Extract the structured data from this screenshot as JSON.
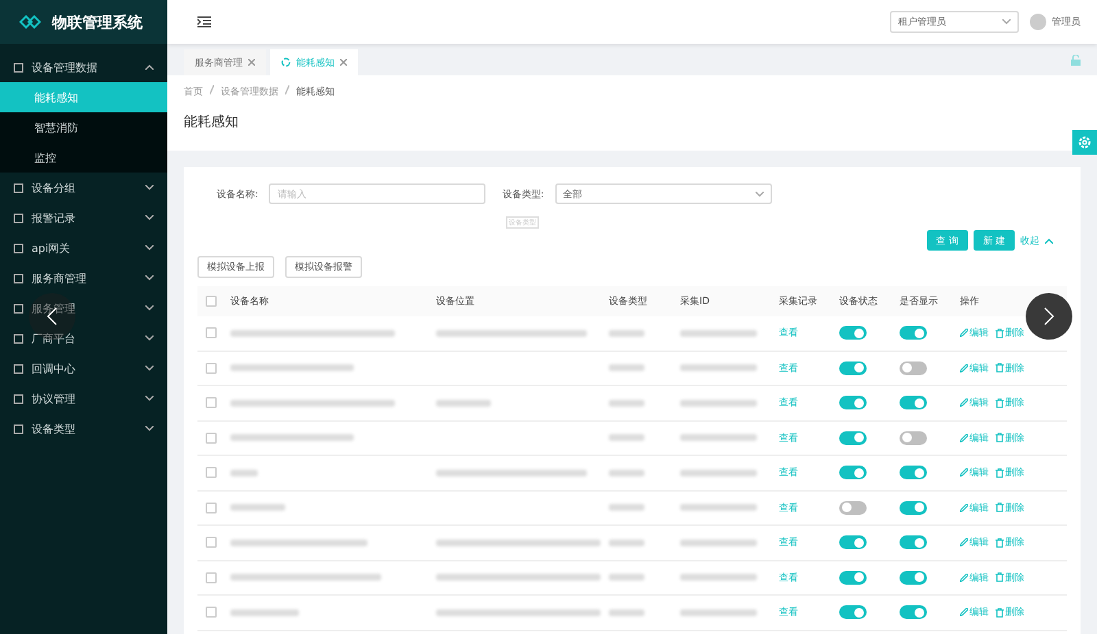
{
  "sidebar": {
    "title": "物联管理系统",
    "items": [
      {
        "label": "设备管理数据",
        "expanded": true,
        "children": [
          {
            "label": "能耗感知",
            "selected": true
          },
          {
            "label": "智慧消防",
            "selected": false
          },
          {
            "label": "监控",
            "selected": false
          }
        ]
      },
      {
        "label": "设备分组",
        "expanded": false
      },
      {
        "label": "报警记录",
        "expanded": false
      },
      {
        "label": "api网关",
        "expanded": false
      },
      {
        "label": "服务商管理",
        "expanded": false
      },
      {
        "label": "服务管理",
        "expanded": false
      },
      {
        "label": "厂商平台",
        "expanded": false
      },
      {
        "label": "回调中心",
        "expanded": false
      },
      {
        "label": "协议管理",
        "expanded": false
      },
      {
        "label": "设备类型",
        "expanded": false
      }
    ]
  },
  "header": {
    "role_select": "租户管理员",
    "user": "管理员"
  },
  "tabs": [
    {
      "label": "服务商管理",
      "selected": false
    },
    {
      "label": "能耗感知",
      "selected": true
    }
  ],
  "breadcrumb": [
    "首页",
    "设备管理数据",
    "能耗感知"
  ],
  "page_title": "能耗感知",
  "filters": {
    "name_label": "设备名称:",
    "name_placeholder": "请输入",
    "type_label": "设备类型:",
    "type_value": "全部",
    "type_hint": "设备类型"
  },
  "actions": {
    "query": "查 询",
    "create": "新 建",
    "collapse": "收起"
  },
  "tool_buttons": [
    "模拟设备上报",
    "模拟设备报警"
  ],
  "table": {
    "all_checked": false,
    "columns": [
      "设备名称",
      "设备位置",
      "设备类型",
      "采集ID",
      "采集记录",
      "设备状态",
      "是否显示",
      "操作"
    ],
    "rows": [
      {
        "checked": false,
        "record": "查看",
        "status_on": true,
        "display_on": true,
        "edit": "编辑",
        "delete": "删除"
      },
      {
        "checked": false,
        "record": "查看",
        "status_on": true,
        "display_on": false,
        "edit": "编辑",
        "delete": "删除"
      },
      {
        "checked": false,
        "record": "查看",
        "status_on": true,
        "display_on": true,
        "edit": "编辑",
        "delete": "删除"
      },
      {
        "checked": false,
        "record": "查看",
        "status_on": true,
        "display_on": false,
        "edit": "编辑",
        "delete": "删除"
      },
      {
        "checked": false,
        "record": "查看",
        "status_on": true,
        "display_on": true,
        "edit": "编辑",
        "delete": "删除"
      },
      {
        "checked": false,
        "record": "查看",
        "status_on": false,
        "display_on": true,
        "edit": "编辑",
        "delete": "删除"
      },
      {
        "checked": false,
        "record": "查看",
        "status_on": true,
        "display_on": true,
        "edit": "编辑",
        "delete": "删除"
      },
      {
        "checked": false,
        "record": "查看",
        "status_on": true,
        "display_on": true,
        "edit": "编辑",
        "delete": "删除"
      },
      {
        "checked": false,
        "record": "查看",
        "status_on": true,
        "display_on": true,
        "edit": "编辑",
        "delete": "删除"
      }
    ]
  }
}
